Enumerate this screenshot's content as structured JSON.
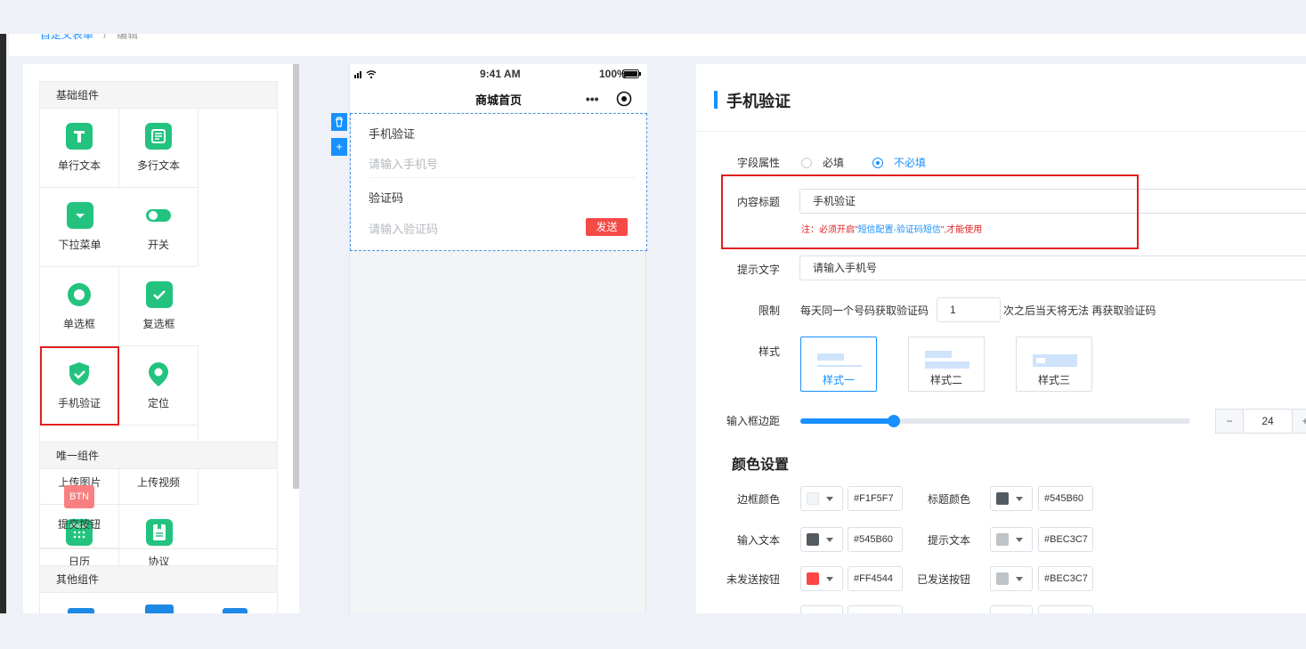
{
  "breadcrumb": {
    "parent": "自定义表单",
    "sep": "/",
    "current": "编辑"
  },
  "palette": {
    "groups": [
      {
        "title": "基础组件",
        "items": [
          {
            "label": "单行文本",
            "icon": "text-icon"
          },
          {
            "label": "多行文本",
            "icon": "textarea-icon"
          },
          {
            "label": "下拉菜单",
            "icon": "dropdown-icon"
          },
          {
            "label": "开关",
            "icon": "toggle-icon"
          },
          {
            "label": "单选框",
            "icon": "radio-icon"
          },
          {
            "label": "复选框",
            "icon": "checkbox-icon"
          },
          {
            "label": "手机验证",
            "icon": "shield-check-icon"
          },
          {
            "label": "定位",
            "icon": "location-pin-icon"
          },
          {
            "label": "上传图片",
            "icon": "camera-icon"
          },
          {
            "label": "上传视频",
            "icon": "video-icon"
          },
          {
            "label": "日历",
            "icon": "calendar-icon"
          },
          {
            "label": "协议",
            "icon": "agreement-icon"
          }
        ]
      },
      {
        "title": "唯一组件",
        "items": [
          {
            "label": "提交按钮",
            "icon": "submit-button-icon",
            "badge": "BTN"
          }
        ]
      },
      {
        "title": "其他组件"
      }
    ]
  },
  "phone": {
    "time": "9:41 AM",
    "battery": "100%",
    "title": "商城首页",
    "form": {
      "field1_label": "手机验证",
      "field1_placeholder": "请输入手机号",
      "field2_label": "验证码",
      "field2_placeholder": "请输入验证码",
      "send_label": "发送"
    }
  },
  "props": {
    "title": "手机验证",
    "field_attr_label": "字段属性",
    "required_opt": "必填",
    "optional_opt": "不必填",
    "content_title_label": "内容标题",
    "content_title_value": "手机验证",
    "note_prefix": "注：必须开启\"",
    "note_link": "短信配置-验证码短信",
    "note_suffix": "\",才能使用",
    "hint_label": "提示文字",
    "hint_value": "请输入手机号",
    "limit_label": "限制",
    "limit_before": "每天同一个号码获取验证码",
    "limit_value": "1",
    "limit_after": "次之后当天将无法 再获取验证码",
    "style_label": "样式",
    "styles": [
      "样式一",
      "样式二",
      "样式三"
    ],
    "margin_label": "输入框边距",
    "margin_value": "24",
    "margin_fraction": 0.24,
    "color_section": "颜色设置",
    "colors": [
      {
        "label": "边框颜色",
        "hex": "#F1F5F7"
      },
      {
        "label": "标题颜色",
        "hex": "#545B60"
      },
      {
        "label": "输入文本",
        "hex": "#545B60"
      },
      {
        "label": "提示文本",
        "hex": "#BEC3C7"
      },
      {
        "label": "未发送按钮",
        "hex": "#FF4544"
      },
      {
        "label": "已发送按钮",
        "hex": "#BEC3C7"
      }
    ]
  },
  "accent": "#1890ff",
  "danger": "#f54a45"
}
